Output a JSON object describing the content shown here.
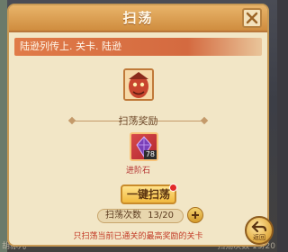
{
  "dialog": {
    "title": "扫荡",
    "level_path": "陆逊列传上. 关卡. 陆逊",
    "reward_title": "扫荡奖励",
    "item": {
      "name": "进阶石",
      "count": "78",
      "icon": "purple-crystal-icon"
    },
    "sweep_button": "一键扫荡",
    "sweep_count_label": "扫荡次数",
    "sweep_count_value": "13/20",
    "note": "只扫荡当前已通关的最高奖励的关卡"
  },
  "back_button": "返回",
  "background": {
    "bottom_left_hint": "胡赤儿",
    "bottom_right_hint": "扫荡次数 13/20"
  },
  "colors": {
    "accent": "#cf8c3e",
    "panel": "#f2e6c6",
    "warning_text": "#c23a26",
    "level_bar": "#d46a40"
  }
}
